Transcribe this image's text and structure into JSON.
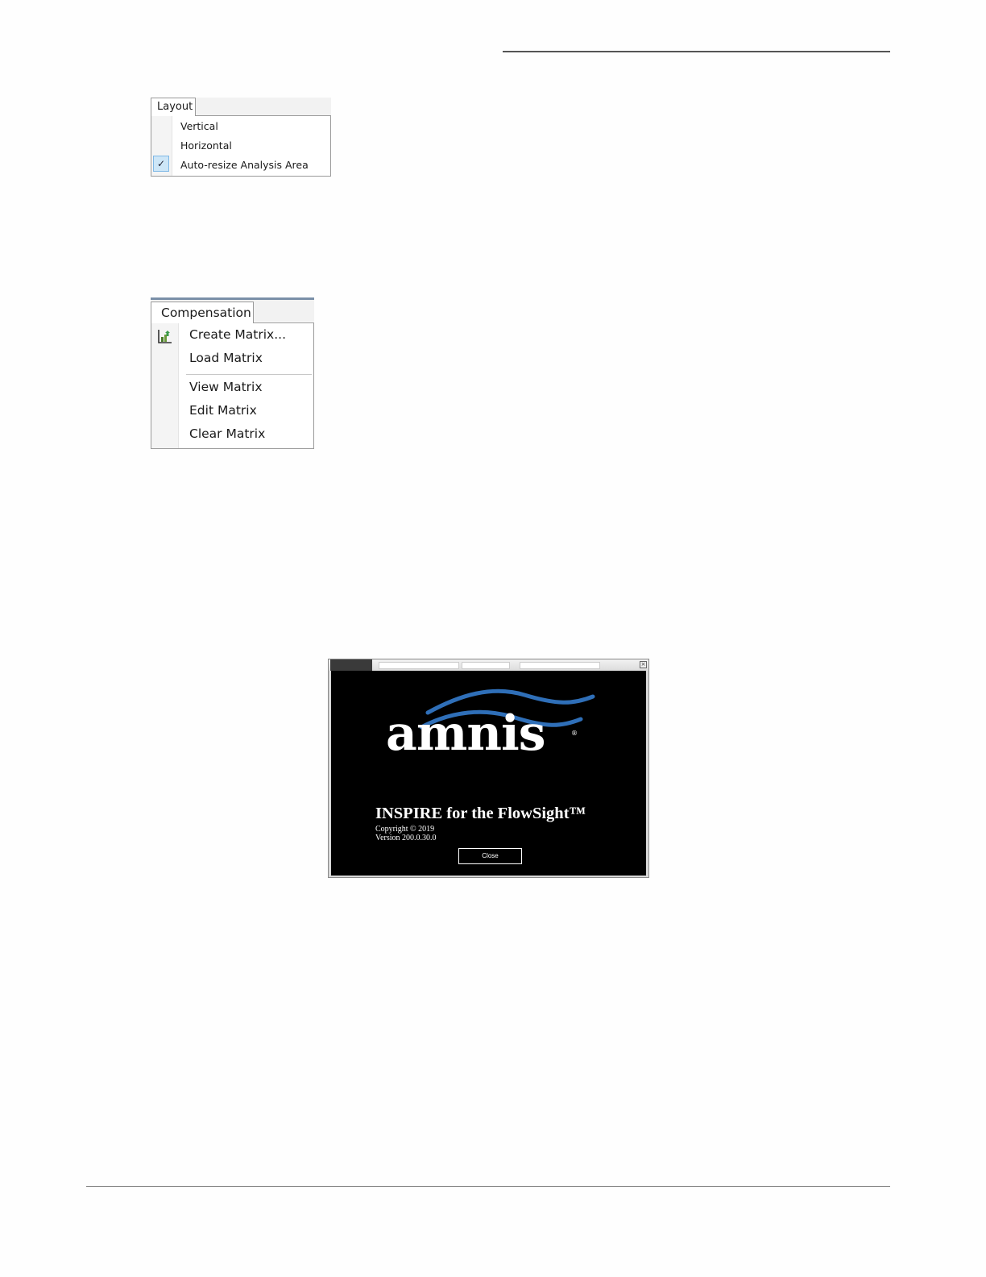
{
  "layout_menu": {
    "tab_label": "Layout",
    "items": [
      "Vertical",
      "Horizontal",
      "Auto-resize Analysis Area"
    ],
    "checked_item": "Auto-resize Analysis Area",
    "check_icon": "checkmark-icon"
  },
  "compensation_menu": {
    "tab_label": "Compensation",
    "items": [
      "Create Matrix...",
      "Load Matrix",
      "View Matrix",
      "Edit Matrix",
      "Clear Matrix"
    ],
    "create_icon": "create-matrix-icon"
  },
  "about_dialog": {
    "logo_text": "amnis",
    "registered_mark": "®",
    "product_name": "INSPIRE for the FlowSight™",
    "copyright": "Copyright © 2019",
    "version": "Version 200.0.30.0",
    "close_label": "Close",
    "colors": {
      "background": "#000000",
      "wave": "#2f6fb8",
      "text": "#ffffff"
    }
  }
}
